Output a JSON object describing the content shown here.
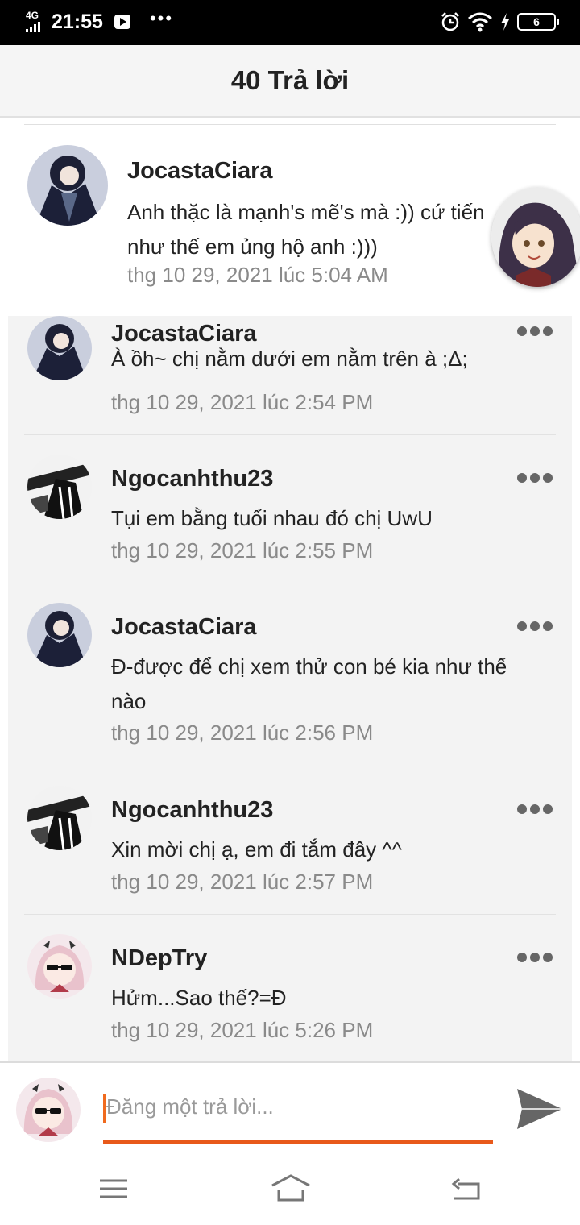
{
  "status_bar": {
    "network": "4G",
    "time": "21:55",
    "battery_level": "6"
  },
  "header": {
    "title": "40 Trả lời"
  },
  "parent_comment": {
    "author": "JocastaCiara",
    "text": "Anh thặc là mạnh's mẽ's mà :)) cứ tiến như thế em ủng hộ anh :)))",
    "timestamp": "thg 10 29, 2021 lúc 5:04 AM"
  },
  "replies": [
    {
      "author": "JocastaCiara",
      "text": "À ồh~ chị nằm dưới em nằm trên à ;Δ;",
      "timestamp": "thg 10 29, 2021 lúc 2:54 PM"
    },
    {
      "author": "Ngocanhthu23",
      "text": "Tụi em bằng tuổi nhau đó chị UwU",
      "timestamp": "thg 10 29, 2021 lúc 2:55 PM"
    },
    {
      "author": "JocastaCiara",
      "text": "Đ-được để chị xem thử con bé kia như thế nào",
      "timestamp": "thg 10 29, 2021 lúc 2:56 PM"
    },
    {
      "author": "Ngocanhthu23",
      "text": "Xin mời chị ạ, em đi tắm đây ^^",
      "timestamp": "thg 10 29, 2021 lúc 2:57 PM"
    },
    {
      "author": "NDepTry",
      "text": "Hửm...Sao thế?=Đ",
      "timestamp": "thg 10 29, 2021 lúc 5:26 PM"
    }
  ],
  "composer": {
    "placeholder": "Đăng một trả lời...",
    "value": ""
  },
  "colors": {
    "accent": "#e8591a",
    "header_bg": "#f5f5f5",
    "reply_bg": "#f3f3f3",
    "timestamp": "#8a8a8a"
  },
  "icons": [
    "signal-icon",
    "youtube-icon",
    "more-dots-icon",
    "alarm-icon",
    "wifi-icon",
    "charging-icon",
    "battery-icon",
    "send-icon",
    "menu-icon",
    "home-icon",
    "back-icon"
  ]
}
